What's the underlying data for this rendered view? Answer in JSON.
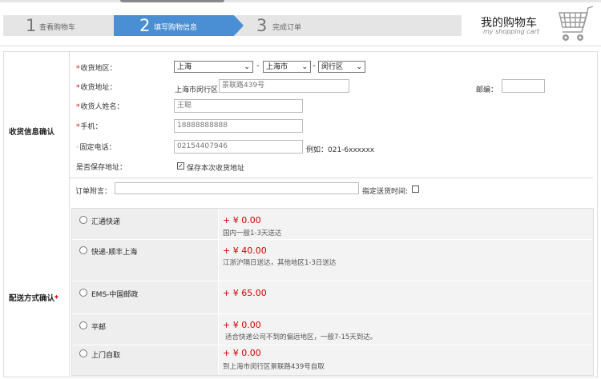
{
  "steps": [
    {
      "num": "1",
      "label": "查看购物车"
    },
    {
      "num": "2",
      "label": "填写购物信息"
    },
    {
      "num": "3",
      "label": "完成订单"
    }
  ],
  "header": {
    "title": "我的购物车",
    "subtitle": "my shopping cart"
  },
  "sections": {
    "receiver": "收货信息确认",
    "shipping": "配送方式确认",
    "required_mark": "*"
  },
  "form": {
    "region": {
      "label": "收货地区：",
      "province": "上海",
      "city": "上海市",
      "district": "闵行区",
      "sep": "-"
    },
    "address": {
      "label": "收货地址：",
      "prefix": "上海市闵行区",
      "value": "景联路439号",
      "zip_label": "邮编：",
      "zip_value": ""
    },
    "name": {
      "label": "收货人姓名：",
      "value": "王聪"
    },
    "mobile": {
      "label": "手机：",
      "value": "18888888888"
    },
    "phone": {
      "label": "固定电话：",
      "value": "02154407946",
      "example": "例如：021-6xxxxxx"
    },
    "save": {
      "label": "是否保存地址：",
      "checkbox_label": "保存本次收货地址",
      "checked": true
    },
    "note": {
      "label": "订单附言：",
      "value": "",
      "delivery_time_label": "指定送货时间:",
      "delivery_time_checked": false
    }
  },
  "shipping_options": [
    {
      "name": "汇通快递",
      "price": "+ ¥ 0.00",
      "desc": "国内一般1-3天送达"
    },
    {
      "name": "快递-顺丰上海",
      "price": "+ ¥ 40.00",
      "desc": "江浙沪隔日送达，其他地区1-3日送达"
    },
    {
      "name": "EMS-中国邮政",
      "price": "+ ¥ 65.00",
      "desc": ""
    },
    {
      "name": "平邮",
      "price": "+ ¥ 0.00",
      "desc": "适合快递公司不到的偏远地区，一般7-15天到达。"
    },
    {
      "name": "上门自取",
      "price": "+ ¥ 0.00",
      "desc": "到上海市闵行区景联路439号自取"
    }
  ],
  "colors": {
    "active_step": "#4a8fd4",
    "inactive_step": "#e5e5e5",
    "price": "#d20000",
    "required": "#cc0000"
  }
}
